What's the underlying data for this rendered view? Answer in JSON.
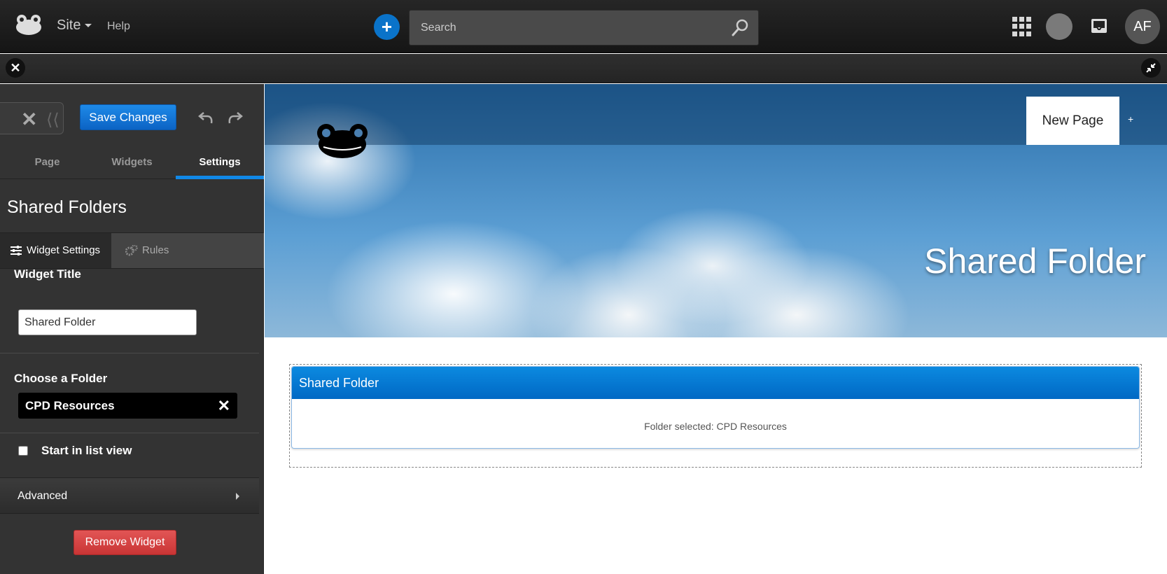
{
  "topbar": {
    "site_label": "Site",
    "help_label": "Help",
    "search_placeholder": "Search",
    "avatar_initials": "AF"
  },
  "sidebar": {
    "save_label": "Save Changes",
    "tabs": [
      {
        "label": "Page"
      },
      {
        "label": "Widgets"
      },
      {
        "label": "Settings"
      }
    ],
    "active_tab": "Settings",
    "panel_title": "Shared Folders",
    "subtabs": [
      {
        "label": "Widget Settings",
        "icon": "sliders-icon"
      },
      {
        "label": "Rules",
        "icon": "gears-icon"
      }
    ],
    "widget_title_label": "Widget Title",
    "widget_title_value": "Shared Folder",
    "choose_folder_label": "Choose a Folder",
    "folder_selected": "CPD Resources",
    "list_view_label": "Start in list view",
    "list_view_checked": false,
    "advanced_label": "Advanced",
    "remove_label": "Remove Widget"
  },
  "page": {
    "nav_tab": "New Page",
    "add_tab": "+",
    "banner_title": "Shared Folder",
    "widget": {
      "title": "Shared Folder",
      "body_text": "Folder selected: CPD Resources"
    }
  },
  "colors": {
    "accent": "#0c73c9",
    "danger": "#d04040",
    "widget_header": "#0a7ad6"
  }
}
